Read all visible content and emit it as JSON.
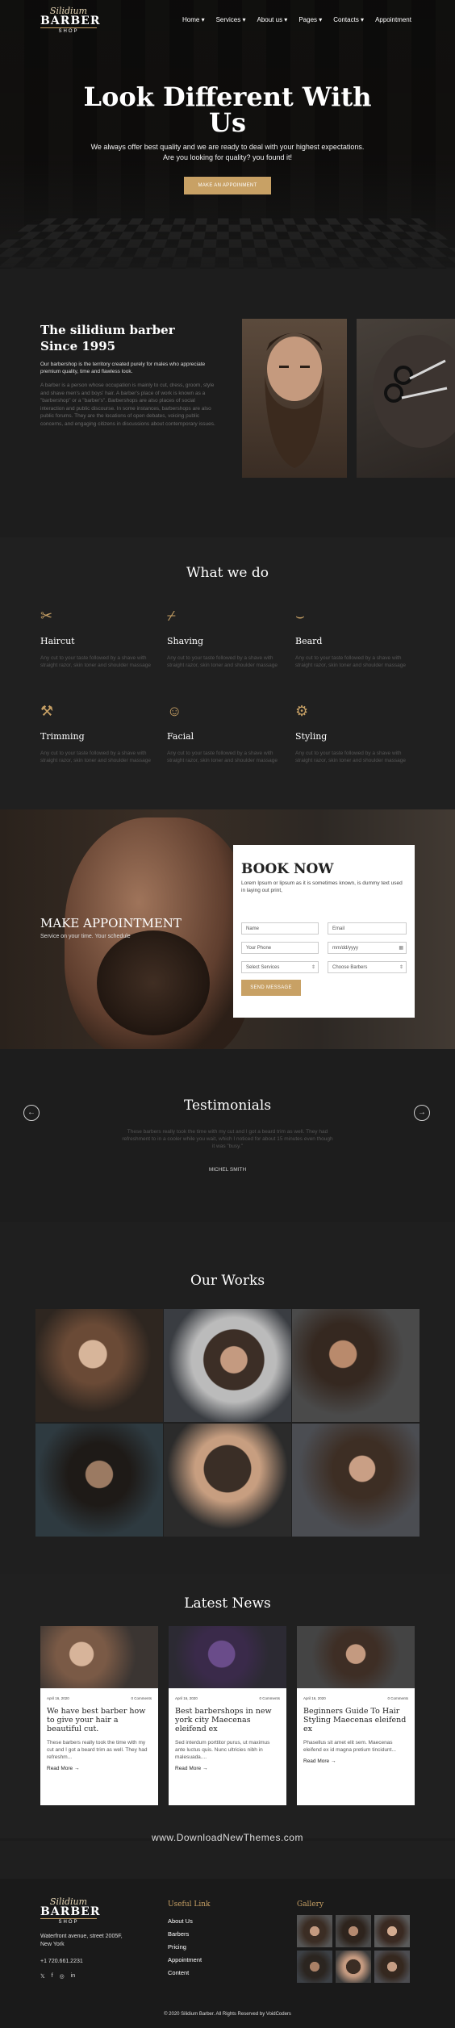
{
  "brand": {
    "line1": "Silidium",
    "line2": "BARBER",
    "line3": "SHOP"
  },
  "nav": {
    "items": [
      "Home ▾",
      "Services ▾",
      "About us ▾",
      "Pages ▾",
      "Contacts ▾",
      "Appointment"
    ]
  },
  "hero": {
    "title": "Look Different With Us",
    "subtitle": "We always offer best quality and we are ready to deal with your highest expectations. Are you looking for quality? you found it!",
    "cta": "MAKE AN APPOINMENT"
  },
  "about": {
    "title": "The silidium barber Since 1995",
    "lead": "Our barbershop is the territory created purely for males who appreciate premium quality, time and flawless look.",
    "body": "A barber is a person whose occupation is mainly to cut, dress, groom, style and shave men's and boys' hair. A barber's place of work is known as a \"barbershop\" or a \"barber's\". Barbershops are also places of social interaction and public discourse. In some instances, barbershops are also public forums. They are the locations of open debates, voicing public concerns, and engaging citizens in discussions about contemporary issues."
  },
  "services": {
    "title": "What we do",
    "items": [
      {
        "icon": "scissors-icon",
        "glyph": "✂",
        "name": "Haircut",
        "desc": "Any cut to your taste followed by a shave with straight razor, skin toner and shoulder massage"
      },
      {
        "icon": "razor-icon",
        "glyph": "⌿",
        "name": "Shaving",
        "desc": "Any cut to your taste followed by a shave with straight razor, skin toner and shoulder massage"
      },
      {
        "icon": "beard-icon",
        "glyph": "⌣",
        "name": "Beard",
        "desc": "Any cut to your taste followed by a shave with straight razor, skin toner and shoulder massage"
      },
      {
        "icon": "trimmer-icon",
        "glyph": "⚒",
        "name": "Trimming",
        "desc": "Any cut to your taste followed by a shave with straight razor, skin toner and shoulder massage"
      },
      {
        "icon": "facial-mask-icon",
        "glyph": "☺",
        "name": "Facial",
        "desc": "Any cut to your taste followed by a shave with straight razor, skin toner and shoulder massage"
      },
      {
        "icon": "hair-dryer-icon",
        "glyph": "⚙",
        "name": "Styling",
        "desc": "Any cut to your taste followed by a shave with straight razor, skin toner and shoulder massage"
      }
    ]
  },
  "appointment": {
    "title": "MAKE APPOINTMENT",
    "tagline": "Service on your time. Your schedule",
    "form_title": "BOOK NOW",
    "form_desc": "Lorem Ipsum or lipsum as it is sometimes known, is dummy text used in laying out print,",
    "name_ph": "Name",
    "email_ph": "Email",
    "phone_ph": "Your Phone",
    "date_ph": "mm/dd/yyyy",
    "service_select": "Select Services",
    "barber_select": "Choose Barbers",
    "submit": "SEND MESSAGE"
  },
  "testimonials": {
    "title": "Testimonials",
    "quote": "These barbers really took the time with my cut and I got a beard trim as well. They had refreshment to in a cooler while you wait, which I noticed for about 15 minutes even though it was \"busy.\"",
    "author": "MICHEL SMITH"
  },
  "works": {
    "title": "Our Works"
  },
  "news": {
    "title": "Latest News",
    "posts": [
      {
        "date": "April 16, 2020",
        "comments": "0 Comments",
        "title": "We have best barber how to give your hair a beautiful cut.",
        "excerpt": "These barbers really took the time with my cut and I got a beard trim as well. They had refreshm...",
        "more": "Read More →"
      },
      {
        "date": "April 16, 2020",
        "comments": "0 Comments",
        "title": "Best barbershops in new york city Maecenas eleifend ex",
        "excerpt": "Sed interdum porttitor purus, ut maximus ante luctus quis. Nunc ultricies nibh in malesuada....",
        "more": "Read More →"
      },
      {
        "date": "April 16, 2020",
        "comments": "0 Comments",
        "title": "Beginners Guide To Hair Styling Maecenas eleifend ex",
        "excerpt": "Phasellus sit amet elit sem. Maecenas eleifend ex id magna pretium tincidunt...",
        "more": "Read More →"
      }
    ]
  },
  "watermark": "www.DownloadNewThemes.com",
  "footer": {
    "address": "Waterfront avenue, street 2005F, New York",
    "phone": "+1 720.661.2231",
    "social": [
      "𝕏",
      "f",
      "◎",
      "in"
    ],
    "links_title": "Useful Link",
    "links": [
      "About Us",
      "Barbers",
      "Pricing",
      "Appointment",
      "Content"
    ],
    "gallery_title": "Gallery",
    "copyright": "© 2020 Silidium Barber. All Rights Reserved by VoidCoders"
  },
  "colors": {
    "accent": "#c8a165",
    "dark": "#1c1c1c",
    "card": "#ffffff"
  }
}
